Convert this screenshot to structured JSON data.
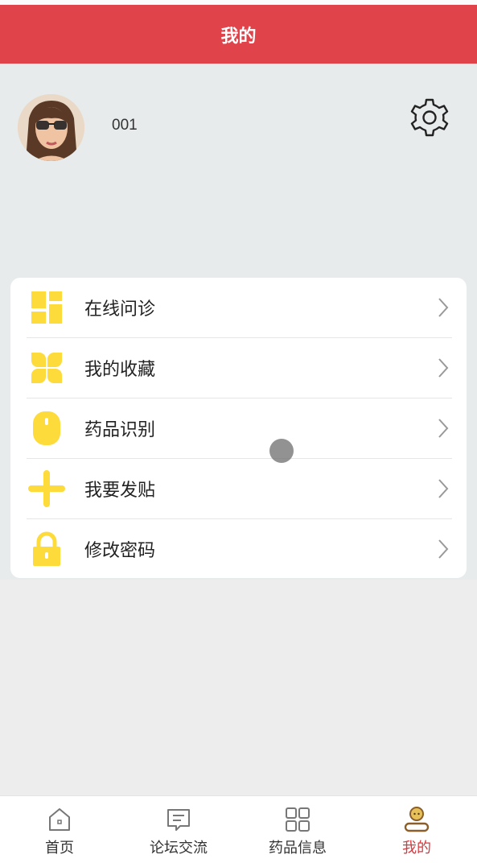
{
  "header": {
    "title": "我的"
  },
  "profile": {
    "username": "001"
  },
  "menu": [
    {
      "label": "在线问诊",
      "icon": "grid-layout-icon"
    },
    {
      "label": "我的收藏",
      "icon": "clover-icon"
    },
    {
      "label": "药品识别",
      "icon": "mouse-icon"
    },
    {
      "label": "我要发贴",
      "icon": "plus-icon"
    },
    {
      "label": "修改密码",
      "icon": "lock-icon"
    }
  ],
  "tabs": [
    {
      "label": "首页",
      "icon": "home-icon"
    },
    {
      "label": "论坛交流",
      "icon": "message-icon"
    },
    {
      "label": "药品信息",
      "icon": "apps-grid-icon"
    },
    {
      "label": "我的",
      "icon": "user-icon",
      "active": true
    }
  ],
  "colors": {
    "accent": "#e0434a",
    "menu_icon": "#fddb3a",
    "active_tab": "#d6393f"
  }
}
